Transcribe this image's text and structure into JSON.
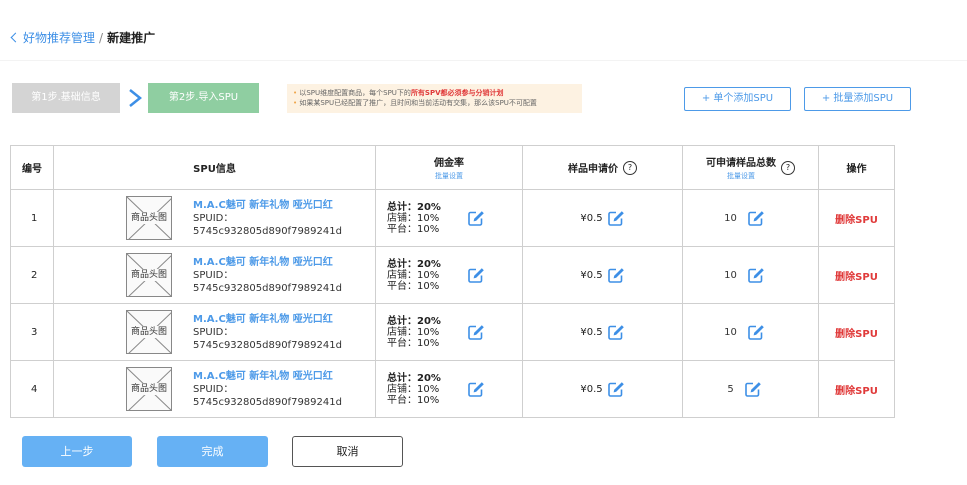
{
  "breadcrumb": {
    "parent": "好物推荐管理",
    "separator": "/",
    "current": "新建推广"
  },
  "steps": [
    {
      "label": "第1步.基础信息",
      "state": "done"
    },
    {
      "label": "第2步.导入SPU",
      "state": "active"
    }
  ],
  "notice": {
    "line1_prefix": "以SPU维度配置商品，每个SPU下的",
    "line1_highlight": "所有SPV都必须参与分销计划",
    "line2": "如果某SPU已经配置了推广，且时间和当前活动有交集，那么该SPU不可配置"
  },
  "actions": {
    "add_single": "+ 单个添加SPU",
    "add_batch": "+ 批量添加SPU"
  },
  "table": {
    "headers": {
      "index": "编号",
      "spu_info": "SPU信息",
      "commission": "佣金率",
      "commission_sub": "批量设置",
      "sample_price": "样品申请价",
      "sample_total": "可申请样品总数",
      "sample_total_sub": "批量设置",
      "operation": "操作"
    },
    "rows": [
      {
        "index": "1",
        "thumb": "商品头图",
        "name": "M.A.C魅可 新年礼物 哑光口红",
        "spuid": "SPUID：5745c932805d890f7989241d",
        "total": "总计：20%",
        "shop": "店铺：10%",
        "platform": "平台：10%",
        "price": "¥0.5",
        "qty": "10",
        "op": "删除SPU"
      },
      {
        "index": "2",
        "thumb": "商品头图",
        "name": "M.A.C魅可 新年礼物 哑光口红",
        "spuid": "SPUID：5745c932805d890f7989241d",
        "total": "总计：20%",
        "shop": "店铺：10%",
        "platform": "平台：10%",
        "price": "¥0.5",
        "qty": "10",
        "op": "删除SPU"
      },
      {
        "index": "3",
        "thumb": "商品头图",
        "name": "M.A.C魅可 新年礼物 哑光口红",
        "spuid": "SPUID：5745c932805d890f7989241d",
        "total": "总计：20%",
        "shop": "店铺：10%",
        "platform": "平台：10%",
        "price": "¥0.5",
        "qty": "10",
        "op": "删除SPU"
      },
      {
        "index": "4",
        "thumb": "商品头图",
        "name": "M.A.C魅可 新年礼物 哑光口红",
        "spuid": "SPUID：5745c932805d890f7989241d",
        "total": "总计：20%",
        "shop": "店铺：10%",
        "platform": "平台：10%",
        "price": "¥0.5",
        "qty": "5",
        "op": "删除SPU"
      }
    ]
  },
  "footer": {
    "prev": "上一步",
    "done": "完成",
    "cancel": "取消"
  },
  "colors": {
    "accent": "#4d9ae8",
    "danger": "#e03a3a",
    "step_done": "#d4d4d4",
    "step_active": "#8fcea1",
    "primary_button": "#66b1f4"
  },
  "icons": {
    "edit": "edit-pencil-icon",
    "help": "question-circle-icon",
    "back": "chevron-left-icon"
  }
}
